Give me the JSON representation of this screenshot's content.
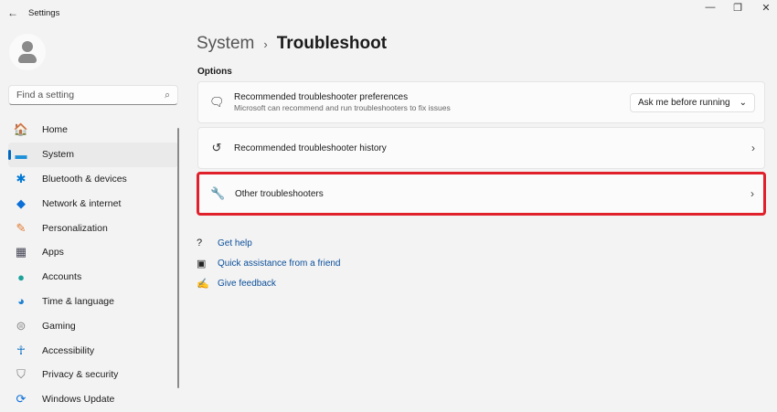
{
  "window": {
    "title": "Settings",
    "minimize": "—",
    "maximize": "❐",
    "close": "✕",
    "back": "←"
  },
  "search": {
    "placeholder": "Find a setting",
    "icon": "⌕"
  },
  "sidebar": {
    "items": [
      {
        "label": "Home",
        "icon": "🏠",
        "color": "#e67e22"
      },
      {
        "label": "System",
        "icon": "▬",
        "color": "#1e90d8"
      },
      {
        "label": "Bluetooth & devices",
        "icon": "✱",
        "color": "#0078d4"
      },
      {
        "label": "Network & internet",
        "icon": "◆",
        "color": "#0a6fd6"
      },
      {
        "label": "Personalization",
        "icon": "✎",
        "color": "#e07a30"
      },
      {
        "label": "Apps",
        "icon": "▦",
        "color": "#445"
      },
      {
        "label": "Accounts",
        "icon": "●",
        "color": "#1aa39a"
      },
      {
        "label": "Time & language",
        "icon": "◕",
        "color": "#1c7fd0"
      },
      {
        "label": "Gaming",
        "icon": "⊜",
        "color": "#888"
      },
      {
        "label": "Accessibility",
        "icon": "☥",
        "color": "#0067c0"
      },
      {
        "label": "Privacy & security",
        "icon": "⛉",
        "color": "#777"
      },
      {
        "label": "Windows Update",
        "icon": "⟳",
        "color": "#0a6fd6"
      }
    ]
  },
  "breadcrumb": {
    "parent": "System",
    "sep": "›",
    "current": "Troubleshoot"
  },
  "section": "Options",
  "cards": [
    {
      "title": "Recommended troubleshooter preferences",
      "desc": "Microsoft can recommend and run troubleshooters to fix issues",
      "icon": "🗨",
      "dropdown": "Ask me before running",
      "dd_chev": "⌄"
    },
    {
      "title": "Recommended troubleshooter history",
      "icon": "↺",
      "chev": "›"
    },
    {
      "title": "Other troubleshooters",
      "icon": "🔧",
      "chev": "›"
    }
  ],
  "links": [
    {
      "label": "Get help",
      "icon": "?"
    },
    {
      "label": "Quick assistance from a friend",
      "icon": "▣"
    },
    {
      "label": "Give feedback",
      "icon": "✍"
    }
  ],
  "highlight_color": "#e0202a"
}
